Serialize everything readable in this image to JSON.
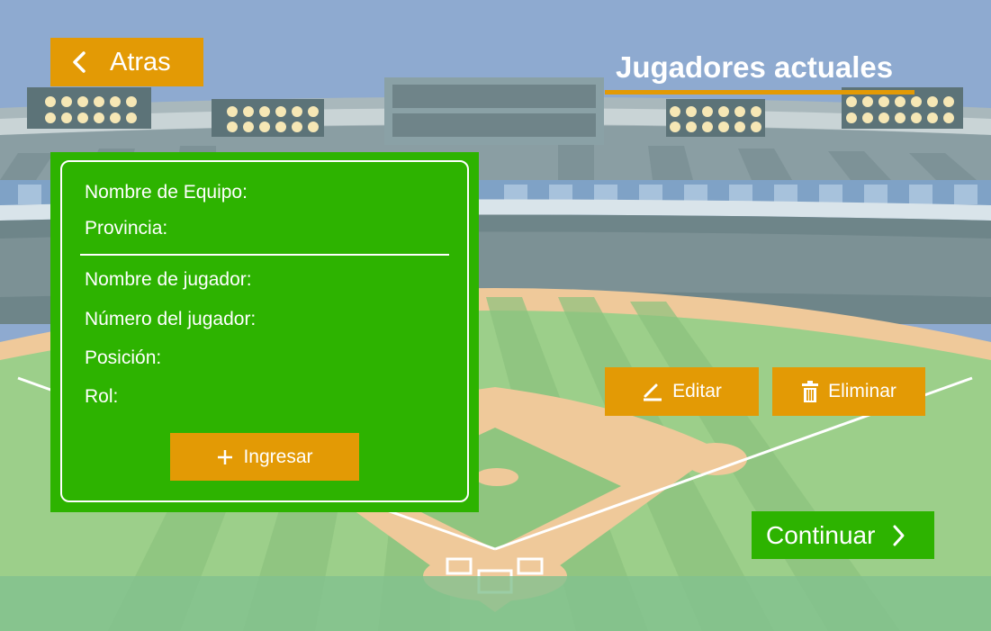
{
  "header": {
    "back_label": "Atras",
    "title": "Jugadores actuales"
  },
  "form": {
    "team_name_label": "Nombre de Equipo:",
    "province_label": "Provincia:",
    "player_name_label": "Nombre de jugador:",
    "player_number_label": "Número del jugador:",
    "position_label": "Posición:",
    "role_label": "Rol:",
    "submit_label": "Ingresar"
  },
  "actions": {
    "edit_label": "Editar",
    "delete_label": "Eliminar",
    "continue_label": "Continuar"
  },
  "icons": {
    "back": "chevron-left-icon",
    "add": "plus-icon",
    "edit": "pencil-icon",
    "delete": "trash-icon",
    "continue": "chevron-right-icon"
  },
  "colors": {
    "accent_orange": "#e39a05",
    "accent_green": "#2db300",
    "sky": "#8eaad0",
    "field": "#7fc48a"
  }
}
